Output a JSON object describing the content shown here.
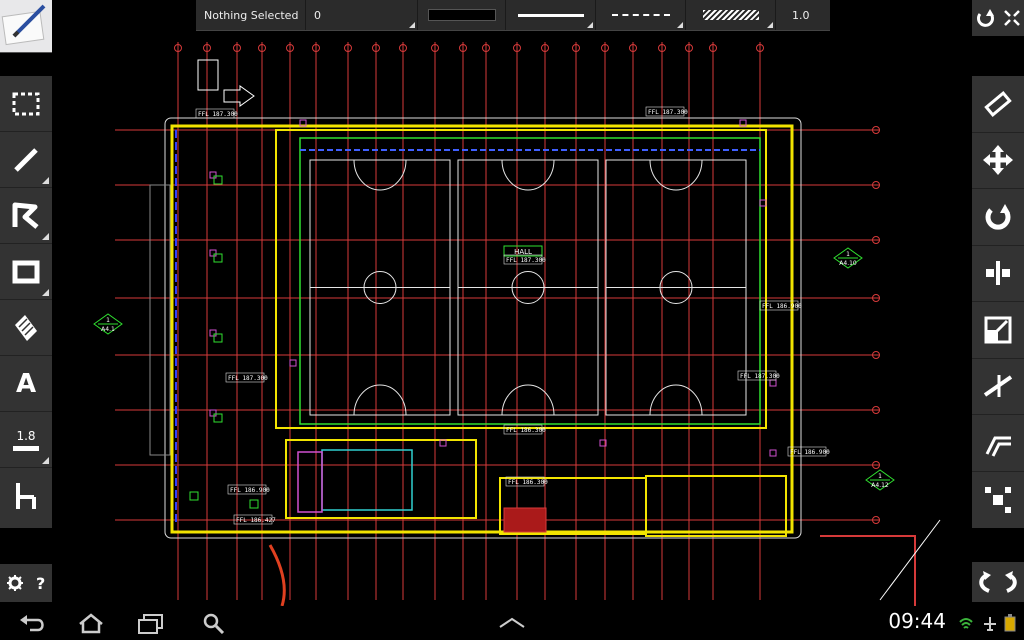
{
  "toolbar": {
    "selection_label": "Nothing Selected",
    "layer_value": "0",
    "scale_value": "1.0"
  },
  "left_tools": [
    {
      "name": "select-rectangle-tool",
      "icon": "dashed-rect-icon"
    },
    {
      "name": "line-tool",
      "icon": "line-icon"
    },
    {
      "name": "polyline-tool",
      "icon": "polyline-icon"
    },
    {
      "name": "rectangle-tool",
      "icon": "rectangle-icon"
    },
    {
      "name": "hatch-tool",
      "icon": "hatch-icon"
    },
    {
      "name": "text-tool",
      "label": "A"
    },
    {
      "name": "lineweight-tool",
      "label": "1.8"
    },
    {
      "name": "dimension-tool",
      "icon": "dimension-icon"
    }
  ],
  "right_tools": [
    {
      "name": "erase-tool",
      "icon": "eraser-icon"
    },
    {
      "name": "move-tool",
      "icon": "move-arrows-icon"
    },
    {
      "name": "rotate-tool",
      "icon": "rotate-icon"
    },
    {
      "name": "mirror-tool",
      "icon": "mirror-icon"
    },
    {
      "name": "scale-tool",
      "icon": "scale-icon"
    },
    {
      "name": "trim-tool",
      "icon": "trim-icon"
    },
    {
      "name": "offset-tool",
      "icon": "offset-icon"
    },
    {
      "name": "explode-tool",
      "icon": "explode-icon"
    }
  ],
  "drawing": {
    "room_label": "HALL",
    "ffl_labels": [
      "FFL 187.300",
      "FFL 187.300",
      "FFL 187.300",
      "FFL 187.300",
      "FFL 187.300",
      "FFL 186.900",
      "FFL 186.900",
      "FFL 186.427",
      "FFL 186.300",
      "FFL 186.900",
      "FFL 186.300"
    ],
    "section_markers": [
      "A4.1",
      "A4.10",
      "A4.12"
    ],
    "section_numbers": [
      "1",
      "1",
      "1"
    ]
  },
  "status_bar": {
    "time": "09:44"
  },
  "colors": {
    "grid_red": "#d63a3a",
    "wall_yellow": "#f2e400",
    "court_white": "#e6e6e6",
    "accent_magenta": "#d050d0",
    "accent_green": "#30e030",
    "accent_cyan": "#30d0d0",
    "toolbar_bg": "#333333"
  }
}
